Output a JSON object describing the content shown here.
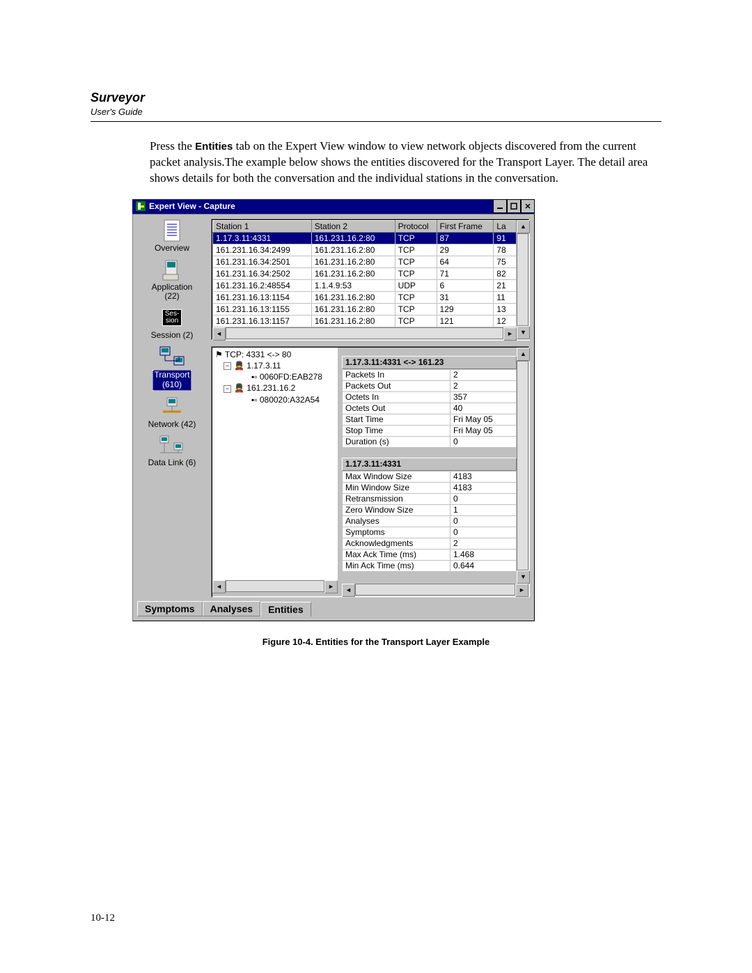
{
  "header": {
    "title": "Surveyor",
    "subtitle": "User's Guide"
  },
  "intro": {
    "part1": "Press the ",
    "entities_word": "Entities",
    "part2": " tab on the Expert View window to view network objects discovered from the current packet analysis.The example below shows the entities discovered for the Transport Layer. The detail area shows details for both the conversation and the individual stations in the conversation."
  },
  "window": {
    "title": "Expert View - Capture"
  },
  "sidebar": [
    {
      "label": "Overview"
    },
    {
      "label": "Application",
      "count": "22"
    },
    {
      "label": "Session",
      "count": "2"
    },
    {
      "label": "Transport",
      "count": "610"
    },
    {
      "label": "Network",
      "count": "42"
    },
    {
      "label": "Data Link",
      "count": "6"
    }
  ],
  "conn_table": {
    "headers": [
      "Station 1",
      "Station 2",
      "Protocol",
      "First Frame",
      "La"
    ],
    "rows": [
      {
        "sel": true,
        "c": [
          "1.17.3.11:4331",
          "161.231.16.2:80",
          "TCP",
          "87",
          "91"
        ]
      },
      {
        "c": [
          "161.231.16.34:2499",
          "161.231.16.2:80",
          "TCP",
          "29",
          "78"
        ]
      },
      {
        "c": [
          "161.231.16.34:2501",
          "161.231.16.2:80",
          "TCP",
          "64",
          "75"
        ]
      },
      {
        "c": [
          "161.231.16.34:2502",
          "161.231.16.2:80",
          "TCP",
          "71",
          "82"
        ]
      },
      {
        "c": [
          "161.231.16.2:48554",
          "1.1.4.9:53",
          "UDP",
          "6",
          "21"
        ]
      },
      {
        "c": [
          "161.231.16.13:1154",
          "161.231.16.2:80",
          "TCP",
          "31",
          "11"
        ]
      },
      {
        "c": [
          "161.231.16.13:1155",
          "161.231.16.2:80",
          "TCP",
          "129",
          "13"
        ]
      },
      {
        "c": [
          "161.231.16.13:1157",
          "161.231.16.2:80",
          "TCP",
          "121",
          "12"
        ]
      }
    ]
  },
  "tree": {
    "root": "TCP: 4331 <-> 80",
    "nodes": [
      {
        "label": "1.17.3.11",
        "children": [
          "0060FD:EAB278"
        ]
      },
      {
        "label": "161.231.16.2",
        "children": [
          "080020:A32A54"
        ]
      }
    ]
  },
  "detail1": {
    "header": "1.17.3.11:4331 <-> 161.23",
    "rows": [
      [
        "Packets In",
        "2"
      ],
      [
        "Packets Out",
        "2"
      ],
      [
        "Octets In",
        "357"
      ],
      [
        "Octets Out",
        "40"
      ],
      [
        "Start Time",
        "Fri May 05"
      ],
      [
        "Stop Time",
        "Fri May 05"
      ],
      [
        "Duration (s)",
        "0"
      ]
    ]
  },
  "detail2": {
    "header": "1.17.3.11:4331",
    "rows": [
      [
        "Max Window Size",
        "4183"
      ],
      [
        "Min Window Size",
        "4183"
      ],
      [
        "Retransmission",
        "0"
      ],
      [
        "Zero Window Size",
        "1"
      ],
      [
        "Analyses",
        "0"
      ],
      [
        "Symptoms",
        "0"
      ],
      [
        "Acknowledgments",
        "2"
      ],
      [
        "Max Ack Time (ms)",
        "1.468"
      ],
      [
        "Min Ack Time (ms)",
        "0.644"
      ]
    ]
  },
  "tabs": [
    "Symptoms",
    "Analyses",
    "Entities"
  ],
  "caption": "Figure 10-4. Entities for the Transport Layer Example",
  "page_number": "10-12"
}
